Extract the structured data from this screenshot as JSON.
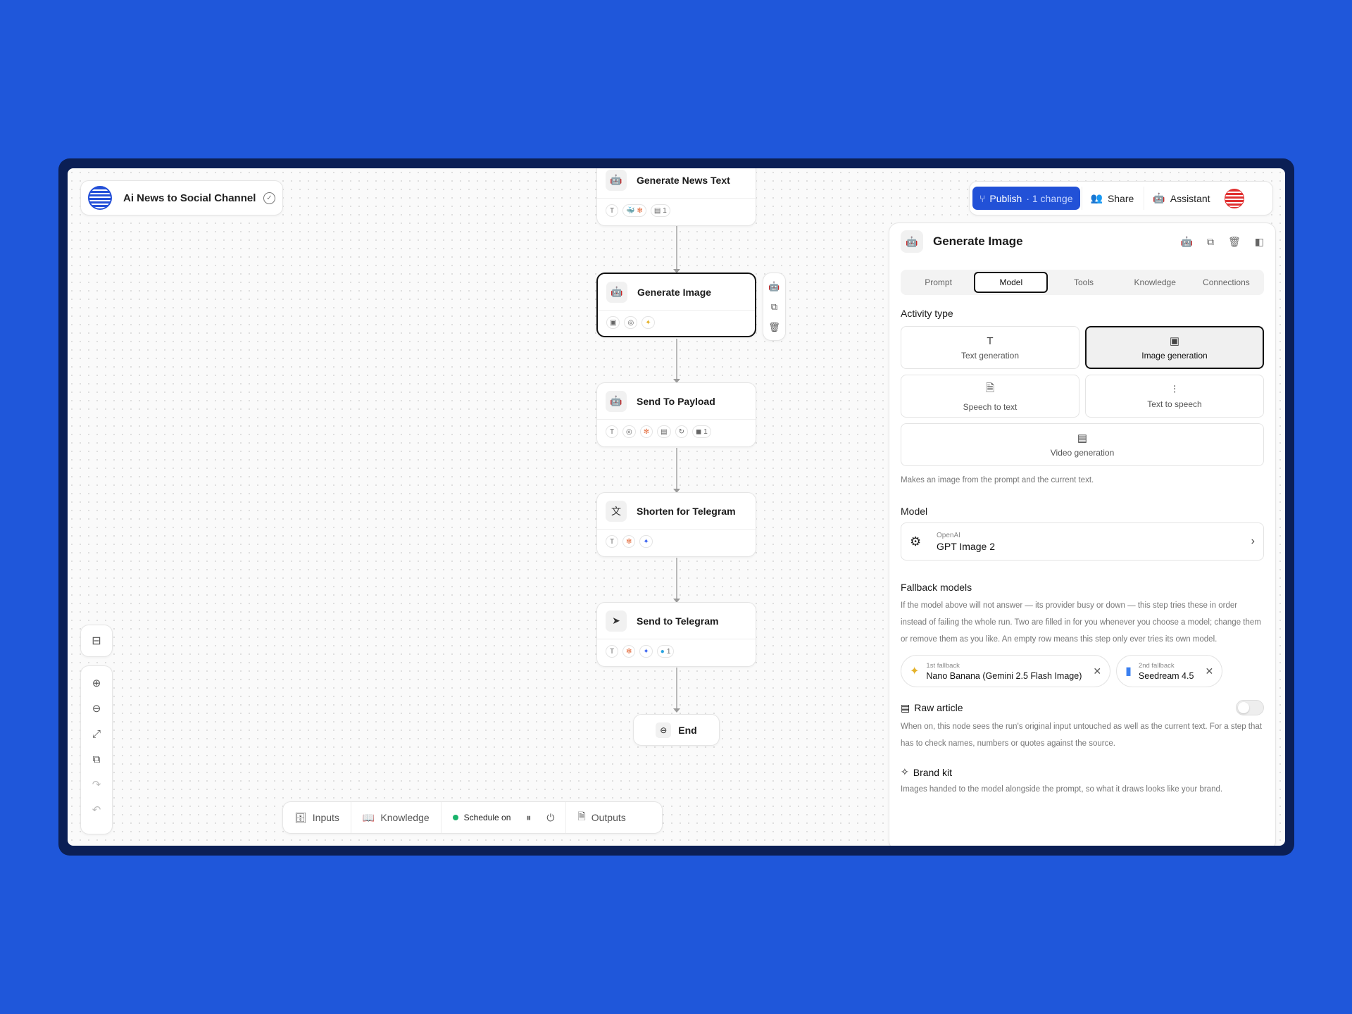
{
  "project": {
    "title": "Ai News to Social Channel"
  },
  "toolbar": {
    "publish_label": "Publish",
    "publish_changes": "· 1 change",
    "share_label": "Share",
    "assistant_label": "Assistant"
  },
  "nodes": [
    {
      "title": "Generate News Text",
      "chips": [
        "T",
        "🐳",
        "✻",
        "1"
      ]
    },
    {
      "title": "Generate Image",
      "chips": [
        "▣",
        "◎",
        "✦"
      ]
    },
    {
      "title": "Send To Payload",
      "chips": [
        "T",
        "◎",
        "✻",
        "▤",
        "↻",
        "1"
      ]
    },
    {
      "title": "Shorten for Telegram",
      "chips": [
        "T",
        "✻",
        "✦"
      ]
    },
    {
      "title": "Send to Telegram",
      "chips": [
        "T",
        "✻",
        "✦",
        "1"
      ]
    }
  ],
  "end_node": {
    "label": "End"
  },
  "bottombar": {
    "inputs": "Inputs",
    "knowledge": "Knowledge",
    "schedule": "Schedule on",
    "outputs": "Outputs"
  },
  "panel": {
    "title": "Generate Image",
    "tabs": [
      "Prompt",
      "Model",
      "Tools",
      "Knowledge",
      "Connections"
    ],
    "active_tab": "Model",
    "activity_type_label": "Activity type",
    "activities": [
      {
        "label": "Text generation",
        "icon": "text-icon",
        "glyph": "T"
      },
      {
        "label": "Image generation",
        "icon": "image-icon",
        "glyph": "▣"
      },
      {
        "label": "Speech to text",
        "icon": "speech-icon",
        "glyph": "🗎"
      },
      {
        "label": "Text to speech",
        "icon": "waveform-icon",
        "glyph": "⫶"
      },
      {
        "label": "Video generation",
        "icon": "video-icon",
        "glyph": "▤"
      }
    ],
    "activity_description": "Makes an image from the prompt and the current text.",
    "model_label": "Model",
    "model": {
      "provider": "OpenAI",
      "name": "GPT Image 2"
    },
    "fallback_label": "Fallback models",
    "fallback_description": "If the model above will not answer — its provider busy or down — this step tries these in order instead of failing the whole run. Two are filled in for you whenever you choose a model; change them or remove them as you like. An empty row means this step only ever tries its own model.",
    "fallbacks": [
      {
        "rank": "1st fallback",
        "name": "Nano Banana (Gemini 2.5 Flash Image)"
      },
      {
        "rank": "2nd fallback",
        "name": "Seedream 4.5"
      }
    ],
    "raw_article_label": "Raw article",
    "raw_article_on": false,
    "raw_article_description": "When on, this node sees the run's original input untouched as well as the current text. For a step that has to check names, numbers or quotes against the source.",
    "brand_kit_label": "Brand kit",
    "brand_kit_description": "Images handed to the model alongside the prompt, so what it draws looks like your brand."
  },
  "colors": {
    "background": "#1f57da",
    "accent": "#2251d7",
    "schedule_dot": "#19b36b"
  }
}
